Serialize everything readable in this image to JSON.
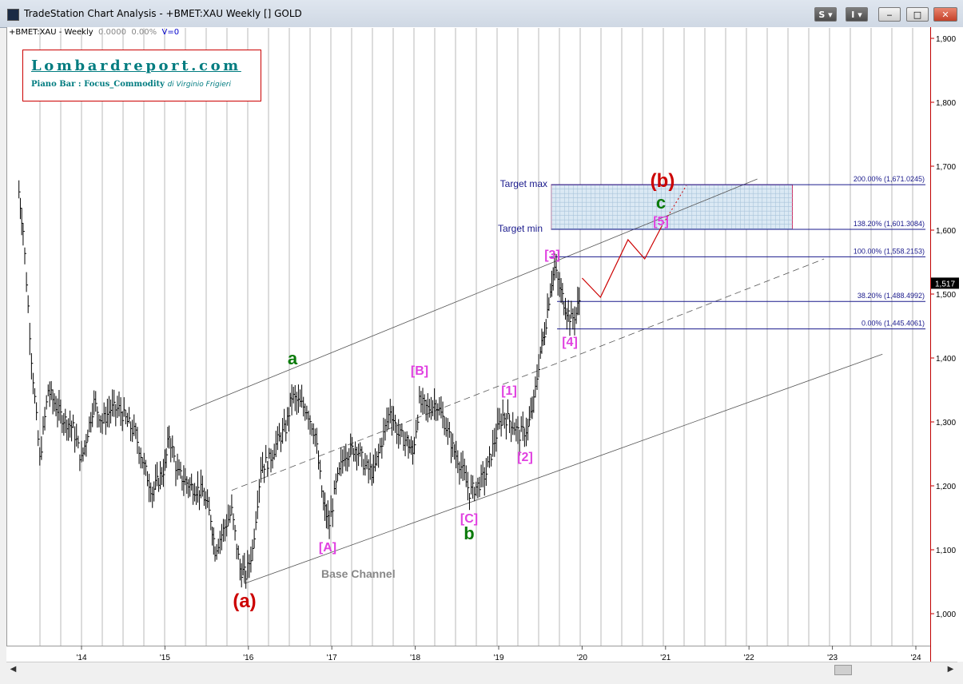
{
  "window": {
    "title": "TradeStation Chart Analysis - +BMET:XAU Weekly [] GOLD",
    "btn_s": "S",
    "btn_i": "I",
    "min_label": "‒",
    "max_label": "□",
    "close_label": "✕"
  },
  "chart_header": {
    "symbol": "+BMET:XAU - Weekly",
    "change": "0.0000",
    "pct": "0.00%",
    "volume": "V=0"
  },
  "logo": {
    "title": "Lombardreport.com",
    "subtitle": "Piano Bar : Focus_Commodity",
    "author": "di Virginio Frigieri"
  },
  "chart_data": {
    "type": "bar",
    "title": "",
    "ylim": [
      950,
      1910
    ],
    "price_axis_labels": [
      "1,900",
      "1,800",
      "1,700",
      "1,600",
      "1,500",
      "1,400",
      "1,300",
      "1,200",
      "1,100",
      "1,000"
    ],
    "time_axis_labels": [
      "'14",
      "'15",
      "'16",
      "'17",
      "'18",
      "'19",
      "'20",
      "'21",
      "'22",
      "'23",
      "'24"
    ],
    "last_price": "1,517",
    "wave_labels": {
      "a_big": "(a)",
      "b_big": "(b)",
      "a_small": "a",
      "b_small": "b",
      "c_small": "c",
      "A": "[A]",
      "B": "[B]",
      "C": "[C]",
      "w1": "[1]",
      "w2": "[2]",
      "w3": "[3]",
      "w4": "[4]",
      "w5": "[5]"
    },
    "annotations": {
      "base_channel": "Base Channel",
      "target_max": "Target max",
      "target_min": "Target min"
    },
    "fib_levels": [
      {
        "label": "200.00% (1,671.0245)",
        "price": 1671.0245
      },
      {
        "label": "138.20% (1,601.3084)",
        "price": 1601.3084
      },
      {
        "label": "100.00% (1,558.2153)",
        "price": 1558.2153
      },
      {
        "label": "38.20% (1,488.4992)",
        "price": 1488.4992
      },
      {
        "label": "0.00% (1,445.4061)",
        "price": 1445.4061
      }
    ],
    "price_path": [
      [
        2013.25,
        1660
      ],
      [
        2013.3,
        1600
      ],
      [
        2013.4,
        1400
      ],
      [
        2013.5,
        1240
      ],
      [
        2013.6,
        1350
      ],
      [
        2013.75,
        1310
      ],
      [
        2013.9,
        1290
      ],
      [
        2014.0,
        1240
      ],
      [
        2014.15,
        1330
      ],
      [
        2014.25,
        1300
      ],
      [
        2014.35,
        1320
      ],
      [
        2014.45,
        1320
      ],
      [
        2014.55,
        1300
      ],
      [
        2014.65,
        1280
      ],
      [
        2014.75,
        1230
      ],
      [
        2014.85,
        1190
      ],
      [
        2015.0,
        1230
      ],
      [
        2015.05,
        1280
      ],
      [
        2015.15,
        1220
      ],
      [
        2015.3,
        1200
      ],
      [
        2015.45,
        1190
      ],
      [
        2015.55,
        1150
      ],
      [
        2015.6,
        1100
      ],
      [
        2015.7,
        1130
      ],
      [
        2015.8,
        1160
      ],
      [
        2015.9,
        1070
      ],
      [
        2015.97,
        1060
      ],
      [
        2016.05,
        1100
      ],
      [
        2016.15,
        1230
      ],
      [
        2016.25,
        1240
      ],
      [
        2016.35,
        1270
      ],
      [
        2016.45,
        1290
      ],
      [
        2016.52,
        1340
      ],
      [
        2016.6,
        1330
      ],
      [
        2016.7,
        1320
      ],
      [
        2016.8,
        1280
      ],
      [
        2016.9,
        1170
      ],
      [
        2016.97,
        1140
      ],
      [
        2017.05,
        1200
      ],
      [
        2017.15,
        1250
      ],
      [
        2017.3,
        1260
      ],
      [
        2017.4,
        1230
      ],
      [
        2017.5,
        1220
      ],
      [
        2017.6,
        1270
      ],
      [
        2017.7,
        1320
      ],
      [
        2017.8,
        1280
      ],
      [
        2017.9,
        1270
      ],
      [
        2017.97,
        1250
      ],
      [
        2018.05,
        1330
      ],
      [
        2018.15,
        1320
      ],
      [
        2018.25,
        1330
      ],
      [
        2018.35,
        1300
      ],
      [
        2018.45,
        1260
      ],
      [
        2018.55,
        1230
      ],
      [
        2018.65,
        1190
      ],
      [
        2018.75,
        1200
      ],
      [
        2018.85,
        1220
      ],
      [
        2018.97,
        1280
      ],
      [
        2019.05,
        1310
      ],
      [
        2019.15,
        1300
      ],
      [
        2019.25,
        1280
      ],
      [
        2019.35,
        1290
      ],
      [
        2019.42,
        1330
      ],
      [
        2019.5,
        1410
      ],
      [
        2019.55,
        1440
      ],
      [
        2019.62,
        1510
      ],
      [
        2019.67,
        1540
      ],
      [
        2019.73,
        1510
      ],
      [
        2019.8,
        1480
      ],
      [
        2019.87,
        1460
      ],
      [
        2019.93,
        1470
      ],
      [
        2019.98,
        1500
      ]
    ],
    "projection_path": [
      [
        2020.0,
        1525
      ],
      [
        2020.22,
        1495
      ],
      [
        2020.55,
        1585
      ],
      [
        2020.75,
        1555
      ],
      [
        2020.95,
        1605
      ]
    ]
  }
}
